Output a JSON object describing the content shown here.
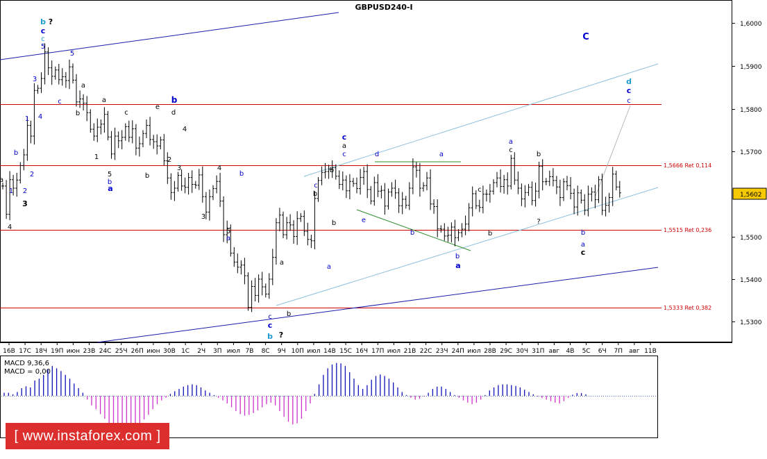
{
  "chart_data": [
    {
      "type": "candlestick",
      "title": "GBPUSD240-I",
      "ylim": [
        1.525,
        1.6035
      ],
      "y_ticks": [
        "1,6000",
        "1,5900",
        "1,5800",
        "1,5700",
        "1,5602",
        "1,5500",
        "1,5400",
        "1,5300"
      ],
      "y_tick_values": [
        1.6,
        1.59,
        1.58,
        1.57,
        1.5602,
        1.55,
        1.54,
        1.53
      ],
      "current_price": "1,5602",
      "x_ticks": [
        "16В",
        "17С",
        "18Ч",
        "19П",
        "июн",
        "23В",
        "24С",
        "25Ч",
        "26П",
        "июн",
        "30В",
        "1С",
        "2Ч",
        "3П",
        "июл",
        "7В",
        "8С",
        "9Ч",
        "10П",
        "июл",
        "14В",
        "15С",
        "16Ч",
        "17П",
        "июл",
        "21В",
        "22С",
        "23Ч",
        "24П",
        "июл",
        "28В",
        "29С",
        "30Ч",
        "31П",
        "авг",
        "4В",
        "5С",
        "6Ч",
        "7П",
        "авг",
        "11В"
      ],
      "candles_close": [
        1.5618,
        1.5552,
        1.5633,
        1.5613,
        1.5632,
        1.5666,
        1.5691,
        1.576,
        1.5735,
        1.5842,
        1.5847,
        1.587,
        1.5932,
        1.5895,
        1.5875,
        1.589,
        1.5867,
        1.5874,
        1.5865,
        1.5897,
        1.5866,
        1.5815,
        1.5822,
        1.5812,
        1.579,
        1.5751,
        1.5735,
        1.5756,
        1.5763,
        1.5786,
        1.5733,
        1.5693,
        1.5735,
        1.5724,
        1.5732,
        1.5757,
        1.5732,
        1.5752,
        1.5707,
        1.5717,
        1.5741,
        1.576,
        1.5727,
        1.5722,
        1.5712,
        1.5726,
        1.5677,
        1.5637,
        1.5603,
        1.5613,
        1.5643,
        1.5618,
        1.5615,
        1.5638,
        1.5622,
        1.562,
        1.5644,
        1.5593,
        1.5557,
        1.5593,
        1.5612,
        1.5629,
        1.5583,
        1.5504,
        1.552,
        1.5461,
        1.544,
        1.5428,
        1.5433,
        1.5408,
        1.5334,
        1.5383,
        1.5362,
        1.54,
        1.5382,
        1.5365,
        1.54,
        1.5451,
        1.5532,
        1.555,
        1.5504,
        1.5532,
        1.5527,
        1.55,
        1.5542,
        1.5547,
        1.5512,
        1.5493,
        1.549,
        1.5589,
        1.5631,
        1.565,
        1.5652,
        1.5657,
        1.5661,
        1.5641,
        1.5622,
        1.5632,
        1.5607,
        1.5629,
        1.5624,
        1.5612,
        1.5638,
        1.5652,
        1.561,
        1.5583,
        1.5626,
        1.5606,
        1.5608,
        1.5571,
        1.5604,
        1.5613,
        1.5602,
        1.5572,
        1.5587,
        1.5573,
        1.5613,
        1.5663,
        1.5655,
        1.5613,
        1.5619,
        1.5637,
        1.5576,
        1.557,
        1.5518,
        1.5517,
        1.5501,
        1.5503,
        1.5522,
        1.5497,
        1.5509,
        1.5517,
        1.5529,
        1.5567,
        1.56,
        1.5572,
        1.5568,
        1.5599,
        1.5599,
        1.5606,
        1.5626,
        1.5637,
        1.5617,
        1.5633,
        1.5618,
        1.5683,
        1.5632,
        1.5613,
        1.5588,
        1.5603,
        1.5615,
        1.5584,
        1.5606,
        1.5664,
        1.5628,
        1.5629,
        1.564,
        1.5631,
        1.5616,
        1.5591,
        1.5628,
        1.5619,
        1.5601,
        1.5569,
        1.5602,
        1.5585,
        1.5561,
        1.5599,
        1.5604,
        1.5586,
        1.5633,
        1.5561,
        1.5573,
        1.5591,
        1.5646,
        1.5616,
        1.5602
      ],
      "annotations": [
        {
          "text": "1,5666 Ret 0,114"
        },
        {
          "text": "1,5515 Ret 0,236"
        },
        {
          "text": "1,5333 Ret 0,382"
        }
      ],
      "wave_labels": [
        "b",
        "?",
        "c",
        "c",
        "5",
        "3",
        "4",
        "1",
        "2",
        "b",
        "a",
        "1",
        "2",
        "3",
        "4",
        "5",
        "c",
        "a",
        "b",
        "a",
        "c",
        "e",
        "b",
        "d",
        "1",
        "4",
        "2",
        "3",
        "5",
        "b",
        "4",
        "b",
        "5",
        "a",
        "b",
        "3",
        "a",
        "c",
        "c",
        "?",
        "b",
        "b",
        "a",
        "c",
        "b",
        "a",
        "b",
        "c",
        "a",
        "c",
        "b",
        "d",
        "e",
        "b",
        "a",
        "b",
        "a",
        "c",
        "b",
        "a",
        "c",
        "b",
        "?",
        "b",
        "a",
        "c",
        "C",
        "d",
        "c",
        "c"
      ],
      "colors": {
        "candle": "#000000",
        "fib": "#cc0000",
        "channel": "#1a1aa8",
        "channel_light": "#8ec0dc",
        "abc_line": "#2e8b2e",
        "wave_blue": "#0000cc",
        "wave_cyan": "#1a9ad0",
        "price_box": "#f7c900"
      }
    },
    {
      "type": "bar",
      "title": "MACD 9,36,6",
      "subtitle": "MACD = 0,00",
      "values": [
        0.08,
        0.08,
        0.04,
        0.1,
        0.2,
        0.25,
        0.22,
        0.4,
        0.45,
        0.55,
        0.7,
        0.78,
        0.72,
        0.65,
        0.55,
        0.45,
        0.32,
        0.2,
        0.08,
        -0.1,
        -0.25,
        -0.35,
        -0.48,
        -0.6,
        -0.72,
        -0.82,
        -0.9,
        -0.95,
        -0.98,
        -0.95,
        -0.9,
        -0.8,
        -0.62,
        -0.5,
        -0.35,
        -0.22,
        -0.12,
        -0.05,
        0.05,
        0.12,
        0.18,
        0.24,
        0.28,
        0.3,
        0.28,
        0.22,
        0.14,
        0.08,
        0.02,
        -0.05,
        -0.12,
        -0.2,
        -0.3,
        -0.4,
        -0.48,
        -0.52,
        -0.5,
        -0.45,
        -0.38,
        -0.3,
        -0.22,
        -0.18,
        -0.25,
        -0.4,
        -0.55,
        -0.68,
        -0.75,
        -0.72,
        -0.6,
        -0.4,
        -0.2,
        0.05,
        0.3,
        0.55,
        0.72,
        0.82,
        0.86,
        0.85,
        0.78,
        0.62,
        0.45,
        0.28,
        0.18,
        0.28,
        0.42,
        0.52,
        0.56,
        0.52,
        0.45,
        0.35,
        0.22,
        0.1,
        0.02,
        -0.05,
        -0.1,
        -0.08,
        -0.02,
        0.08,
        0.18,
        0.24,
        0.24,
        0.18,
        0.1,
        0.02,
        -0.05,
        -0.12,
        -0.18,
        -0.22,
        -0.18,
        -0.1,
        0.02,
        0.14,
        0.22,
        0.28,
        0.3,
        0.3,
        0.28,
        0.26,
        0.22,
        0.16,
        0.1,
        0.04,
        -0.02,
        -0.06,
        -0.1,
        -0.14,
        -0.18,
        -0.2,
        -0.14,
        -0.05,
        0.03,
        0.07,
        0.07,
        0.04
      ],
      "colors": {
        "positive": "#1010b8",
        "negative": "#cc33cc",
        "zero": "#4a6ac8"
      }
    }
  ],
  "watermark": "[ www.instaforex.com ]"
}
